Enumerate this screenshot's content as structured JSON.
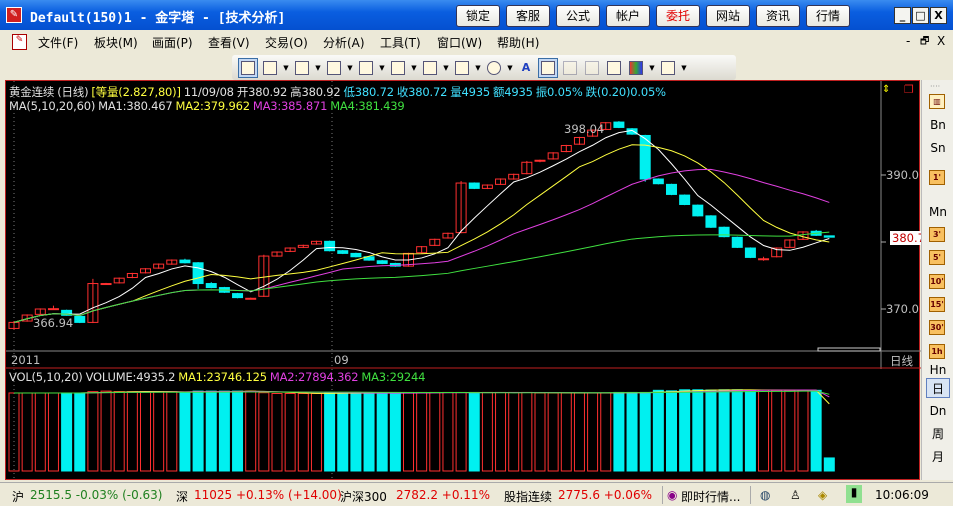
{
  "window": {
    "title": "Default(150)1 - 金字塔 - [技术分析]",
    "buttons": [
      "锁定",
      "客服",
      "公式",
      "帐户",
      "委托",
      "网站",
      "资讯",
      "行情"
    ],
    "controls": [
      "_",
      "□",
      "X"
    ]
  },
  "menu": {
    "items": [
      "文件(F)",
      "板块(M)",
      "画面(P)",
      "查看(V)",
      "交易(O)",
      "分析(A)",
      "工具(T)",
      "窗口(W)",
      "帮助(H)"
    ],
    "mdi_controls": [
      "-",
      "🗗",
      "X"
    ]
  },
  "toolbar": {
    "icons": [
      "select-draw",
      "line",
      "text-list",
      "vertical-lines",
      "fan",
      "parallel",
      "hatch",
      "rectangle",
      "ellipse",
      "text-A",
      "copy",
      "cross-disabled",
      "eraser-disabled",
      "lock",
      "color-grid",
      "settings"
    ]
  },
  "chart_header": {
    "symbol": "黄金连续",
    "period": "(日线)",
    "mode": "[等量(2.827,80)]",
    "date": "11/09/08",
    "open": "开380.92",
    "high": "高380.92",
    "low": "低380.72",
    "close": "收380.72",
    "vol": "量4935",
    "amount": "额4935",
    "amp": "振0.05%",
    "change": "跌(0.20)0.05%",
    "ma_label": "MA(5,10,20,60)",
    "ma1": "MA1:380.467",
    "ma2": "MA2:379.962",
    "ma3": "MA3:385.871",
    "ma4": "MA4:381.439",
    "high_label": "398.04",
    "low_label": "366.94"
  },
  "vol_header": {
    "label": "VOL(5,10,20)",
    "volume": "VOLUME:4935.2",
    "ma1": "MA1:23746.125",
    "ma2": "MA2:27894.362",
    "ma3": "MA3:29244"
  },
  "axis": {
    "price_ticks": [
      "390.0",
      "370.0"
    ],
    "price_tick_values": [
      390,
      370
    ],
    "current_price": "380.7",
    "dates": [
      "2011",
      "09"
    ],
    "period_label": "日线"
  },
  "colors": {
    "up": "#ff3030",
    "down": "#00f0f0",
    "ma1": "#ffffff",
    "ma2": "#ffff40",
    "ma3": "#e040e0",
    "ma4": "#40e040"
  },
  "chart_data": {
    "type": "candlestick",
    "ohlc": [
      [
        367.1,
        368.0,
        368.2,
        366.94
      ],
      [
        368.2,
        369.1,
        369.2,
        368.1
      ],
      [
        369.2,
        370.0,
        370.1,
        369.1
      ],
      [
        370.05,
        370.05,
        370.5,
        370.0
      ],
      [
        369.8,
        369.06,
        369.9,
        369.0
      ],
      [
        368.9,
        368.0,
        369.0,
        367.9
      ],
      [
        368.0,
        373.8,
        374.5,
        367.9
      ],
      [
        373.8,
        373.8,
        373.9,
        373.6
      ],
      [
        373.9,
        374.6,
        374.7,
        373.8
      ],
      [
        374.7,
        375.3,
        375.4,
        374.6
      ],
      [
        375.4,
        376.0,
        376.1,
        375.3
      ],
      [
        376.1,
        376.7,
        376.8,
        376.0
      ],
      [
        376.7,
        377.3,
        377.4,
        376.6
      ],
      [
        377.3,
        376.9,
        377.5,
        376.8
      ],
      [
        376.9,
        373.8,
        377.0,
        373.0
      ],
      [
        373.8,
        373.2,
        374.0,
        373.1
      ],
      [
        373.2,
        372.5,
        373.3,
        372.4
      ],
      [
        372.3,
        371.7,
        372.4,
        371.6
      ],
      [
        371.6,
        371.6,
        371.7,
        371.5
      ],
      [
        371.9,
        377.9,
        378.1,
        371.8
      ],
      [
        377.9,
        378.5,
        378.6,
        377.8
      ],
      [
        378.6,
        379.1,
        379.2,
        378.5
      ],
      [
        379.2,
        379.5,
        379.6,
        379.1
      ],
      [
        379.7,
        380.1,
        380.2,
        379.6
      ],
      [
        380.1,
        378.7,
        380.2,
        378.6
      ],
      [
        378.7,
        378.3,
        378.8,
        378.2
      ],
      [
        378.3,
        377.8,
        378.4,
        377.7
      ],
      [
        377.8,
        377.3,
        377.9,
        377.2
      ],
      [
        377.2,
        376.8,
        377.3,
        376.7
      ],
      [
        376.8,
        376.4,
        376.9,
        376.3
      ],
      [
        376.4,
        378.3,
        378.4,
        376.3
      ],
      [
        378.4,
        379.3,
        379.4,
        378.3
      ],
      [
        379.5,
        380.4,
        380.5,
        379.4
      ],
      [
        380.6,
        381.3,
        381.4,
        380.5
      ],
      [
        381.4,
        388.8,
        389.1,
        381.3
      ],
      [
        388.8,
        388.0,
        388.9,
        387.9
      ],
      [
        388.0,
        388.5,
        388.6,
        387.9
      ],
      [
        388.6,
        389.4,
        389.5,
        388.5
      ],
      [
        389.4,
        390.1,
        390.2,
        389.3
      ],
      [
        390.2,
        391.9,
        392.1,
        390.1
      ],
      [
        392.2,
        392.2,
        392.3,
        391.9
      ],
      [
        392.4,
        393.3,
        393.4,
        392.3
      ],
      [
        393.5,
        394.4,
        394.5,
        393.4
      ],
      [
        394.6,
        395.6,
        395.7,
        394.5
      ],
      [
        395.8,
        396.7,
        396.8,
        395.7
      ],
      [
        396.8,
        397.8,
        397.9,
        396.7
      ],
      [
        397.9,
        397.1,
        398.04,
        397.0
      ],
      [
        396.9,
        396.1,
        397.0,
        396.0
      ],
      [
        395.9,
        389.4,
        396.0,
        389.0
      ],
      [
        389.4,
        388.7,
        389.5,
        388.6
      ],
      [
        388.6,
        387.1,
        388.7,
        387.0
      ],
      [
        387.0,
        385.6,
        387.1,
        385.5
      ],
      [
        385.5,
        383.9,
        385.6,
        383.8
      ],
      [
        383.9,
        382.2,
        384.0,
        382.1
      ],
      [
        382.2,
        380.8,
        382.3,
        380.7
      ],
      [
        380.7,
        379.2,
        380.8,
        379.1
      ],
      [
        379.1,
        377.7,
        379.2,
        377.6
      ],
      [
        377.5,
        377.5,
        377.8,
        377.2
      ],
      [
        377.8,
        379.1,
        379.2,
        377.7
      ],
      [
        379.2,
        380.3,
        380.4,
        379.1
      ],
      [
        380.4,
        381.5,
        381.6,
        380.3
      ],
      [
        381.6,
        381.0,
        381.8,
        380.9
      ],
      [
        380.92,
        380.72,
        380.92,
        380.72
      ]
    ],
    "volume": [
      29500,
      29500,
      29500,
      29500,
      29500,
      29500,
      30000,
      30200,
      30000,
      30000,
      30000,
      30000,
      30000,
      29500,
      30200,
      30200,
      30200,
      30200,
      30200,
      29600,
      29300,
      29300,
      29300,
      29300,
      29500,
      29500,
      29500,
      29500,
      29500,
      29500,
      29700,
      29700,
      29700,
      29700,
      29700,
      29700,
      29700,
      29700,
      29700,
      29700,
      29500,
      29500,
      29500,
      29500,
      29500,
      29500,
      29700,
      29700,
      29700,
      30500,
      30300,
      30700,
      30700,
      30600,
      30700,
      30700,
      30600,
      30600,
      30500,
      30500,
      30500,
      30500,
      4935
    ],
    "ylim": [
      362,
      402
    ],
    "vol_max": 31000
  },
  "sidebar": {
    "items": [
      "Bn",
      "Sn",
      "1'",
      "Mn",
      "3'",
      "5'",
      "10'",
      "15'",
      "30'",
      "1h",
      "Hn",
      "日",
      "Dn",
      "周",
      "月"
    ]
  },
  "statusbar": {
    "sh_label": "沪",
    "sh_value": "2515.5 -0.03% (-0.63)",
    "sz_label": "深",
    "sz_value": "11025 +0.13% (+14.00)",
    "hs300_label": "沪深300",
    "hs300_value": "2782.2 +0.11%",
    "idx_label": "股指连续",
    "idx_value": "2775.6 +0.06%",
    "quote": "即时行情...",
    "time": "10:06:09"
  }
}
